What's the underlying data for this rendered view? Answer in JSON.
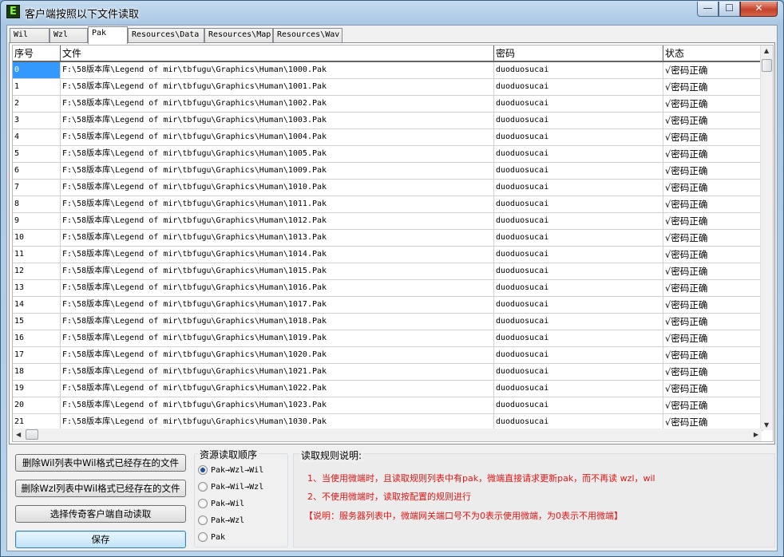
{
  "window": {
    "title": "客户端按照以下文件读取",
    "icon_letter": "E",
    "min_glyph": "—",
    "max_glyph": "☐",
    "close_glyph": "✕"
  },
  "tabs": [
    {
      "label": "Wil",
      "active": false
    },
    {
      "label": "Wzl",
      "active": false
    },
    {
      "label": "Pak",
      "active": true
    },
    {
      "label": "Resources\\Data",
      "active": false
    },
    {
      "label": "Resources\\Map",
      "active": false
    },
    {
      "label": "Resources\\Wav",
      "active": false
    }
  ],
  "table": {
    "columns": [
      "序号",
      "文件",
      "密码",
      "状态"
    ],
    "rows": [
      [
        "0",
        "F:\\58版本库\\Legend of mir\\tbfugu\\Graphics\\Human\\1000.Pak",
        "duoduosucai",
        "√密码正确"
      ],
      [
        "1",
        "F:\\58版本库\\Legend of mir\\tbfugu\\Graphics\\Human\\1001.Pak",
        "duoduosucai",
        "√密码正确"
      ],
      [
        "2",
        "F:\\58版本库\\Legend of mir\\tbfugu\\Graphics\\Human\\1002.Pak",
        "duoduosucai",
        "√密码正确"
      ],
      [
        "3",
        "F:\\58版本库\\Legend of mir\\tbfugu\\Graphics\\Human\\1003.Pak",
        "duoduosucai",
        "√密码正确"
      ],
      [
        "4",
        "F:\\58版本库\\Legend of mir\\tbfugu\\Graphics\\Human\\1004.Pak",
        "duoduosucai",
        "√密码正确"
      ],
      [
        "5",
        "F:\\58版本库\\Legend of mir\\tbfugu\\Graphics\\Human\\1005.Pak",
        "duoduosucai",
        "√密码正确"
      ],
      [
        "6",
        "F:\\58版本库\\Legend of mir\\tbfugu\\Graphics\\Human\\1009.Pak",
        "duoduosucai",
        "√密码正确"
      ],
      [
        "7",
        "F:\\58版本库\\Legend of mir\\tbfugu\\Graphics\\Human\\1010.Pak",
        "duoduosucai",
        "√密码正确"
      ],
      [
        "8",
        "F:\\58版本库\\Legend of mir\\tbfugu\\Graphics\\Human\\1011.Pak",
        "duoduosucai",
        "√密码正确"
      ],
      [
        "9",
        "F:\\58版本库\\Legend of mir\\tbfugu\\Graphics\\Human\\1012.Pak",
        "duoduosucai",
        "√密码正确"
      ],
      [
        "10",
        "F:\\58版本库\\Legend of mir\\tbfugu\\Graphics\\Human\\1013.Pak",
        "duoduosucai",
        "√密码正确"
      ],
      [
        "11",
        "F:\\58版本库\\Legend of mir\\tbfugu\\Graphics\\Human\\1014.Pak",
        "duoduosucai",
        "√密码正确"
      ],
      [
        "12",
        "F:\\58版本库\\Legend of mir\\tbfugu\\Graphics\\Human\\1015.Pak",
        "duoduosucai",
        "√密码正确"
      ],
      [
        "13",
        "F:\\58版本库\\Legend of mir\\tbfugu\\Graphics\\Human\\1016.Pak",
        "duoduosucai",
        "√密码正确"
      ],
      [
        "14",
        "F:\\58版本库\\Legend of mir\\tbfugu\\Graphics\\Human\\1017.Pak",
        "duoduosucai",
        "√密码正确"
      ],
      [
        "15",
        "F:\\58版本库\\Legend of mir\\tbfugu\\Graphics\\Human\\1018.Pak",
        "duoduosucai",
        "√密码正确"
      ],
      [
        "16",
        "F:\\58版本库\\Legend of mir\\tbfugu\\Graphics\\Human\\1019.Pak",
        "duoduosucai",
        "√密码正确"
      ],
      [
        "17",
        "F:\\58版本库\\Legend of mir\\tbfugu\\Graphics\\Human\\1020.Pak",
        "duoduosucai",
        "√密码正确"
      ],
      [
        "18",
        "F:\\58版本库\\Legend of mir\\tbfugu\\Graphics\\Human\\1021.Pak",
        "duoduosucai",
        "√密码正确"
      ],
      [
        "19",
        "F:\\58版本库\\Legend of mir\\tbfugu\\Graphics\\Human\\1022.Pak",
        "duoduosucai",
        "√密码正确"
      ],
      [
        "20",
        "F:\\58版本库\\Legend of mir\\tbfugu\\Graphics\\Human\\1023.Pak",
        "duoduosucai",
        "√密码正确"
      ],
      [
        "21",
        "F:\\58版本库\\Legend of mir\\tbfugu\\Graphics\\Human\\1030.Pak",
        "duoduosucai",
        "√密码正确"
      ]
    ],
    "selected_row": 0
  },
  "buttons": {
    "delete_wil": "删除Wil列表中Wil格式已经存在的文件",
    "delete_wzl": "删除Wzl列表中Wil格式已经存在的文件",
    "select_client": "选择传奇客户端自动读取",
    "save": "保存"
  },
  "order": {
    "title": "资源读取顺序",
    "options": [
      "Pak→Wzl→Wil",
      "Pak→Wil→Wzl",
      "Pak→Wil",
      "Pak→Wzl",
      "Pak"
    ],
    "selected": 0
  },
  "rules": {
    "title": "读取规则说明:",
    "line1": "1、当使用微端时，且读取规则列表中有pak，微端直接请求更新pak，而不再读 wzl，wil",
    "line2": "2、不使用微端时，读取按配置的规则进行",
    "note": "【说明：服务器列表中，微端网关端口号不为0表示使用微端，为0表示不用微端】"
  },
  "colors": {
    "rule_text": "#e31414",
    "selection": "#3399ff"
  }
}
